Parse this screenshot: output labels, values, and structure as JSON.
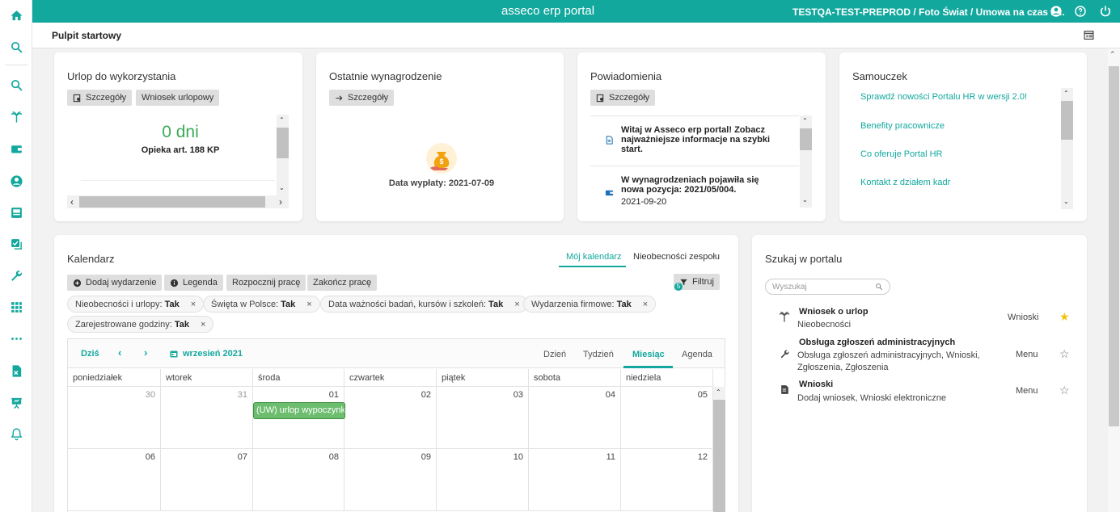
{
  "topbar": {
    "brand": "asseco erp portal",
    "context": "TESTQA-TEST-PREPROD / Foto Świat / Umowa na czas n...",
    "accent": "#13a89e"
  },
  "page": {
    "title": "Pulpit startowy"
  },
  "rail": {
    "icons": [
      "home-icon",
      "search-icon",
      "search-icon",
      "palm-tree-icon",
      "wallet-icon",
      "user-icon",
      "inbox-icon",
      "approval-icon",
      "wrench-icon",
      "apps-icon",
      "more-icon",
      "xls-icon",
      "presentation-icon",
      "bell-icon"
    ]
  },
  "urlop": {
    "title": "Urlop do wykorzystania",
    "btn_details": "Szczegóły",
    "btn_request": "Wniosek urlopowy",
    "value": "0 dni",
    "label": "Opieka art. 188 KP"
  },
  "wynagrodzenie": {
    "title": "Ostatnie wynagrodzenie",
    "btn_details": "Szczegóły",
    "payout": "Data wypłaty: 2021-07-09"
  },
  "powiadomienia": {
    "title": "Powiadomienia",
    "btn_details": "Szczegóły",
    "items": [
      {
        "text": "Witaj w Asseco erp portal! Zobacz najważniejsze informacje na szybki start."
      },
      {
        "text": "W wynagrodzeniach pojawiła się nowa pozycja: 2021/05/004.",
        "date": "2021-09-20"
      }
    ]
  },
  "samouczek": {
    "title": "Samouczek",
    "links": [
      "Sprawdź nowości Portalu HR w wersji 2.0!",
      "Benefity pracownicze",
      "Co oferuje Portal HR",
      "Kontakt z działem kadr"
    ]
  },
  "kalendarz": {
    "title": "Kalendarz",
    "tab_mine": "Mój kalendarz",
    "tab_team": "Nieobecności zespołu",
    "actions": {
      "add": "Dodaj wydarzenie",
      "legend": "Legenda",
      "start": "Rozpocznij pracę",
      "end": "Zakończ pracę",
      "filter": "Filtruj",
      "filter_count": "5"
    },
    "chips": [
      {
        "label": "Nieobecności i urlopy:",
        "value": "Tak"
      },
      {
        "label": "Święta w Polsce:",
        "value": "Tak"
      },
      {
        "label": "Data ważności badań, kursów i szkoleń:",
        "value": "Tak"
      },
      {
        "label": "Wydarzenia firmowe:",
        "value": "Tak"
      },
      {
        "label": "Zarejestrowane godziny:",
        "value": "Tak"
      }
    ],
    "nav": {
      "today": "Dziś",
      "prev": "‹",
      "next": "›",
      "month": "wrzesień 2021"
    },
    "views": [
      "Dzień",
      "Tydzień",
      "Miesiąc",
      "Agenda"
    ],
    "days": [
      "poniedziałek",
      "wtorek",
      "środa",
      "czwartek",
      "piątek",
      "sobota",
      "niedziela"
    ],
    "week1": [
      "30",
      "31",
      "01",
      "02",
      "03",
      "04",
      "05"
    ],
    "week2": [
      "06",
      "07",
      "08",
      "09",
      "10",
      "11",
      "12"
    ],
    "event": "(UW) urlop wypoczynkowy"
  },
  "szukaj": {
    "title": "Szukaj w portalu",
    "placeholder": "Wyszukaj",
    "results": [
      {
        "title": "Wniosek o urlop",
        "sub": "Nieobecności",
        "category": "Wnioski",
        "starred": true
      },
      {
        "title": "Obsługa zgłoszeń administracyjnych",
        "sub": "Obsługa zgłoszeń administracyjnych, Wnioski, Zgłoszenia, Zgłoszenia",
        "category": "Menu",
        "starred": false
      },
      {
        "title": "Wnioski",
        "sub": "Dodaj wniosek, Wnioski elektroniczne",
        "category": "Menu",
        "starred": false
      }
    ]
  }
}
